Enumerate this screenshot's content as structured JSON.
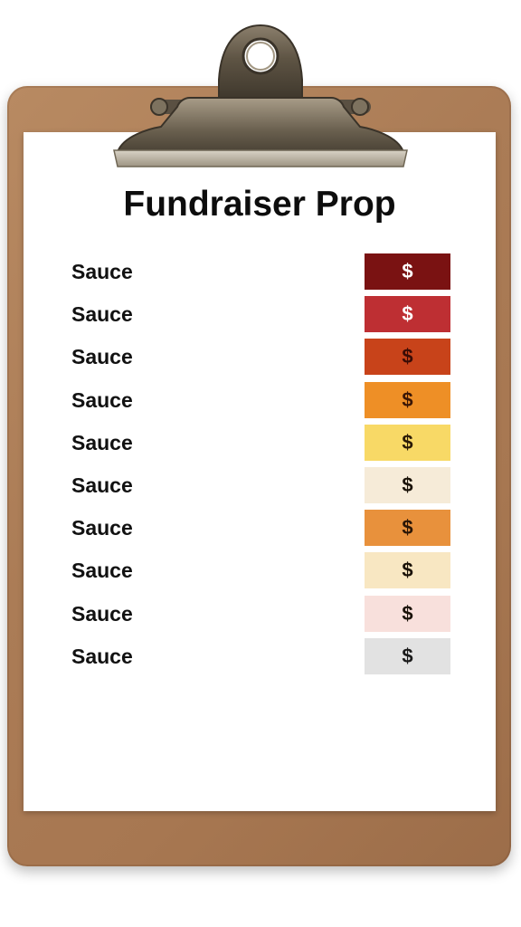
{
  "title": "Fundraiser Prop",
  "rows": [
    {
      "label": "Sauce",
      "price": "$",
      "color": "#7a1212",
      "text_color": "#ffffff"
    },
    {
      "label": "Sauce",
      "price": "$",
      "color": "#be2f33",
      "text_color": "#ffffff"
    },
    {
      "label": "Sauce",
      "price": "$",
      "color": "#c8431a",
      "text_color": "#3a0c06"
    },
    {
      "label": "Sauce",
      "price": "$",
      "color": "#ee8f26",
      "text_color": "#3a1606"
    },
    {
      "label": "Sauce",
      "price": "$",
      "color": "#f8d966",
      "text_color": "#2a1a06"
    },
    {
      "label": "Sauce",
      "price": "$",
      "color": "#f6ebd8",
      "text_color": "#1a1208"
    },
    {
      "label": "Sauce",
      "price": "$",
      "color": "#e8913c",
      "text_color": "#2a1606"
    },
    {
      "label": "Sauce",
      "price": "$",
      "color": "#f8e7c2",
      "text_color": "#1a1208"
    },
    {
      "label": "Sauce",
      "price": "$",
      "color": "#f8e0dc",
      "text_color": "#1a1208"
    },
    {
      "label": "Sauce",
      "price": "$",
      "color": "#e2e2e2",
      "text_color": "#1a1a1a"
    }
  ],
  "icons": {
    "clip": "clipboard-clip-icon"
  },
  "colors": {
    "board": "#ab7c56",
    "paper": "#ffffff"
  }
}
